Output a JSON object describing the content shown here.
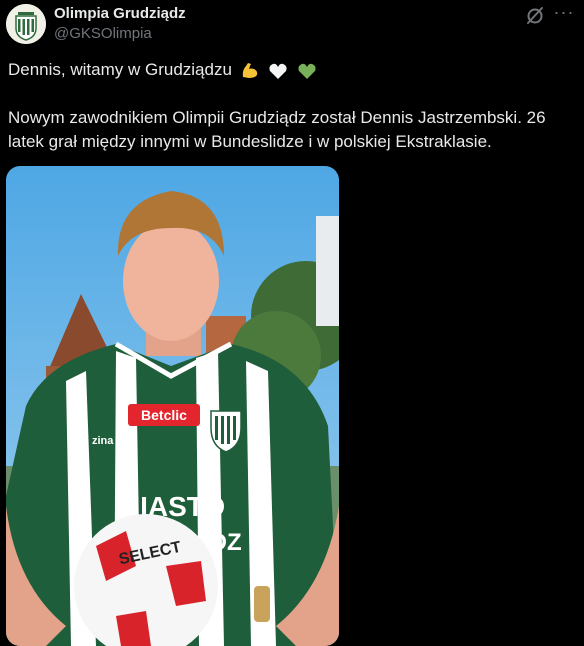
{
  "author": {
    "display_name": "Olimpia Grudziądz",
    "handle": "@GKSOlimpia"
  },
  "icons": {
    "avatar": "club-crest-icon",
    "grok": "grok-slash-icon",
    "more": "more-horizontal-icon",
    "emojis": [
      "flexed-biceps-emoji",
      "white-heart-emoji",
      "green-heart-emoji"
    ]
  },
  "post": {
    "line1": "Dennis, witamy w Grudziądzu",
    "line2": "Nowym zawodnikiem Olimpii Grudziądz został Dennis Jastrzembski. 26 latek grał między innymi w Bundeslidze i w polskiej Ekstraklasie."
  },
  "media": {
    "shirt_sponsor": "Betclic",
    "kit_brand": "zina",
    "chest_text_1": "MIASTO",
    "chest_text_2": "GRUDZIĄDZ",
    "ball_text": "SELECT"
  },
  "colors": {
    "background": "#000000",
    "text": "#e7e9ea",
    "secondary": "#71767b",
    "kit_green": "#1f5e3a",
    "sponsor_red": "#e3262e"
  }
}
